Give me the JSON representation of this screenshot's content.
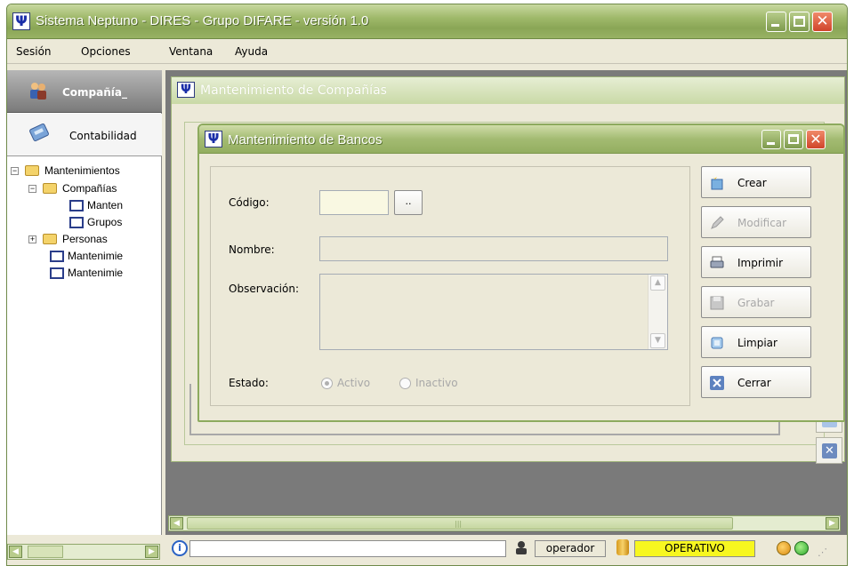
{
  "window": {
    "title": "Sistema Neptuno - DIRES - Grupo DIFARE - versión 1.0",
    "app_icon_glyph": "Ψ"
  },
  "menu": [
    {
      "label": "Sesión"
    },
    {
      "label": "Opciones"
    },
    {
      "label": "Ventana"
    },
    {
      "label": "Ayuda"
    }
  ],
  "sidebar": {
    "header_label": "Compañía_",
    "section_label": "Contabilidad",
    "tree": [
      {
        "label": "Mantenimientos",
        "level": 0,
        "expander": "−",
        "icon": "folder-icon"
      },
      {
        "label": "Compañías",
        "level": 1,
        "expander": "−",
        "icon": "folder-icon"
      },
      {
        "label": "Manten",
        "level": 2,
        "expander": "",
        "icon": "window-icon"
      },
      {
        "label": "Grupos",
        "level": 2,
        "expander": "",
        "icon": "window-icon"
      },
      {
        "label": "Personas",
        "level": 1,
        "expander": "+",
        "icon": "folder-icon"
      },
      {
        "label": "Mantenimie",
        "level": 1,
        "expander": "",
        "icon": "window-icon"
      },
      {
        "label": "Mantenimie",
        "level": 1,
        "expander": "",
        "icon": "window-icon"
      }
    ]
  },
  "background_window": {
    "title": "Mantenimiento de Compañías"
  },
  "dialog": {
    "title": "Mantenimiento de Bancos",
    "fields": {
      "codigo_label": "Código:",
      "codigo_value": "",
      "lookup_label": "..",
      "nombre_label": "Nombre:",
      "nombre_value": "",
      "observacion_label": "Observación:",
      "observacion_value": "",
      "estado_label": "Estado:",
      "estado_options": [
        "Activo",
        "Inactivo"
      ],
      "estado_selected": "Activo"
    },
    "actions": [
      {
        "label": "Crear",
        "enabled": true,
        "icon": "new-document-icon"
      },
      {
        "label": "Modificar",
        "enabled": false,
        "icon": "pencil-icon"
      },
      {
        "label": "Imprimir",
        "enabled": true,
        "icon": "printer-icon"
      },
      {
        "label": "Grabar",
        "enabled": false,
        "icon": "floppy-disk-icon"
      },
      {
        "label": "Limpiar",
        "enabled": true,
        "icon": "clear-icon"
      },
      {
        "label": "Cerrar",
        "enabled": true,
        "icon": "close-icon"
      }
    ]
  },
  "status": {
    "user": "operador",
    "state": "OPERATIVO",
    "state_color": "#f7f720"
  }
}
